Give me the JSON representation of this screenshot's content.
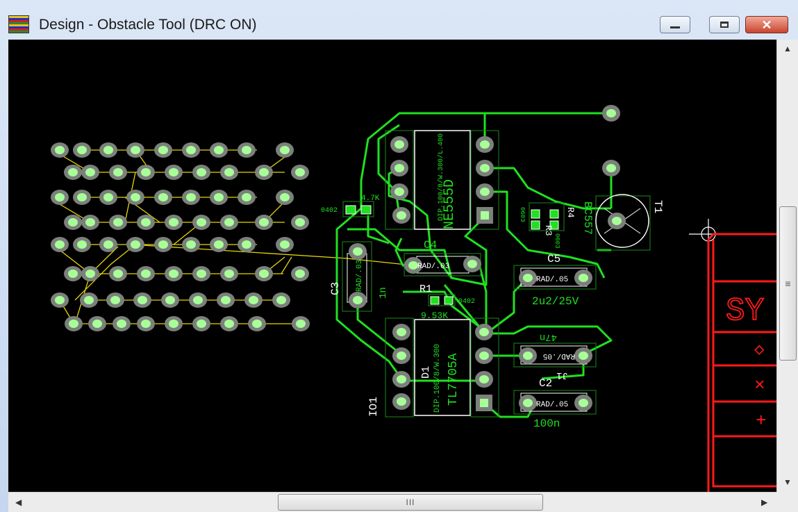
{
  "window": {
    "title": "Design - Obstacle Tool (DRC ON)",
    "icons": {
      "app": "pcb-app-icon",
      "minimize": "minimize-icon",
      "maximize": "maximize-icon",
      "close": "close-icon"
    }
  },
  "pcb": {
    "components": {
      "u1_value": "NE555D",
      "u1_footprint": "DIP.100/8/W.300/L.400",
      "c4": "C4",
      "c4_fp": "RAD/.03",
      "c3": "C3",
      "c3_fp": "RAD/.03",
      "c3_value": "1n",
      "r1": "R1",
      "r1_value": "9.53K",
      "r1_fp": "0402",
      "r_left_fp": "0402",
      "r_left_value": "4.7K",
      "r3": "R3",
      "r4": "R4",
      "r3_fp": "0603",
      "r4_fp": "0603",
      "c5": "C5",
      "c5_fp": "RAD/.05",
      "c5_value": "2u2/25V",
      "t1": "T1",
      "t1_value": "BC557",
      "d1": "D1",
      "d1_value": "TL7705A",
      "d1_fp": "DIP.100/8/W.300",
      "io1": "IO1",
      "c1_value": "47n",
      "c1_fp": "RAD/.05",
      "c2": "C2",
      "c2_fp": "RAD/.05",
      "c2_value": "100n",
      "j1": "J1"
    },
    "panel": {
      "label": "SY",
      "symbols": [
        "◇",
        "×",
        "+"
      ]
    }
  },
  "scrollbars": {
    "h_grip": "III",
    "v_grip": "≡"
  }
}
